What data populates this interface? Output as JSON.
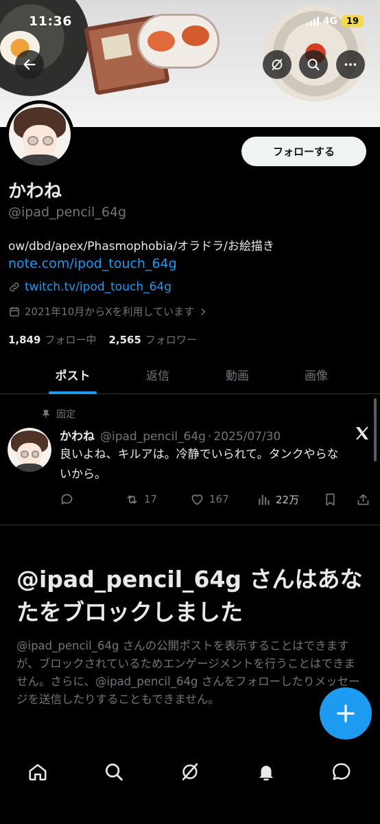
{
  "status_bar": {
    "time": "11:36",
    "network": "4G",
    "battery": "19"
  },
  "header": {
    "back_icon": "arrow-left-icon",
    "grok_icon": "grok-icon",
    "search_icon": "search-icon",
    "more_icon": "more-icon"
  },
  "profile": {
    "display_name": "かわね",
    "handle": "@ipad_pencil_64g",
    "bio": "ow/dbd/apex/Phasmophobia/オラドラ/お絵描き",
    "bio_link": "note.com/ipod_touch_64g",
    "website": "twitch.tv/ipod_touch_64g",
    "joined": "2021年10月からXを利用しています",
    "following_count": "1,849",
    "following_label": "フォロー中",
    "followers_count": "2,565",
    "followers_label": "フォロワー",
    "follow_button": "フォローする"
  },
  "tabs": [
    {
      "label": "ポスト",
      "active": true
    },
    {
      "label": "返信",
      "active": false
    },
    {
      "label": "動画",
      "active": false
    },
    {
      "label": "画像",
      "active": false
    }
  ],
  "pinned_post": {
    "pin_label": "固定",
    "name": "かわね",
    "handle": "@ipad_pencil_64g",
    "separator": "·",
    "date": "2025/07/30",
    "text": "良いよね、キルアは。冷静でいられて。タンクやらないから。",
    "retweets": "17",
    "likes": "167",
    "views": "22万"
  },
  "blocked": {
    "title": "@ipad_pencil_64g さんはあなたをブロックしました",
    "description": "@ipad_pencil_64g さんの公開ポストを表示することはできますが、ブロックされているためエンゲージメントを行うことはできません。さらに、@ipad_pencil_64g さんをフォローしたりメッセージを送信したりすることもできません。"
  },
  "colors": {
    "accent": "#1d9bf0",
    "muted": "#71767b",
    "text": "#e7e9ea",
    "background": "#000000"
  },
  "bottom_nav": [
    "home-icon",
    "search-icon",
    "grok-icon",
    "notifications-icon",
    "messages-icon"
  ]
}
